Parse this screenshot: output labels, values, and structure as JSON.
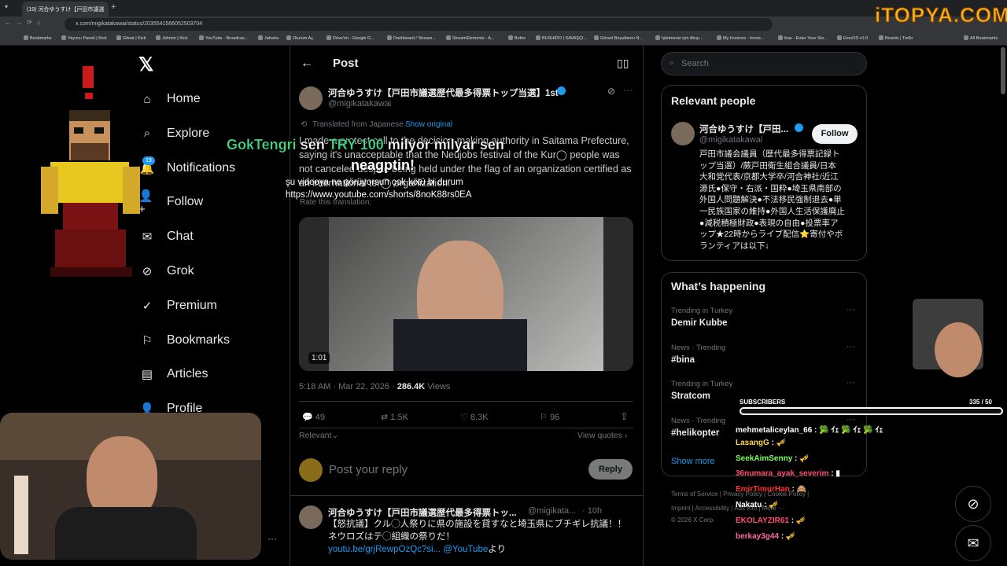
{
  "browser": {
    "tab_title": "(19) 河合ゆうすけ【戸田市議選",
    "url": "x.com/migikatakawai/status/2035541566052503704",
    "bookmarks": [
      "Bookmarks",
      "Yayıncı Paneli | Kick",
      "Gitoat | Kick",
      "Jahmin | Kick",
      "YouTube - Broadcas...",
      "Jaharia",
      "Oturum Aç",
      "Drive'ım - Google D...",
      "Dashboard / Stream...",
      "StreamElements - A...",
      "Botrix",
      "BUSHIDO | SAVAŞÇI...",
      "Görsel Boyutlarını N...",
      "İşletmeniz için Akışı...",
      "My Invoices - Invoic...",
      "ikas - Enter Your Sto...",
      "EmuOS v1.0",
      "Boards | Trello",
      "All Bookmarks"
    ]
  },
  "nav": {
    "items": [
      "Home",
      "Explore",
      "Notifications",
      "Follow",
      "Chat",
      "Grok",
      "Premium",
      "Bookmarks",
      "Articles",
      "Profile"
    ],
    "notif_count": "19"
  },
  "post": {
    "header": "Post",
    "author_name": "河合ゆうすけ【戸田市議選歴代最多得票トップ当選】1st",
    "handle": "@migikatakawai",
    "translated_label": "Translated from Japanese",
    "show_original": "Show original",
    "text": "I made a protest call to the decision-making authority in Saitama Prefecture, saying it's unacceptable that the Neujobs festival of the Kur◯ people was not canceled despite being held under the flag of an organization certified as an international ter◯ organization.",
    "link": "https://www.youtube.com/shorts/8noK88rs0EA",
    "rate": "Rate this translation:",
    "video_duration": "1:01",
    "time": "5:18 AM · Mar 22, 2026 · ",
    "views": "286.4K",
    "views_label": " Views",
    "replies": "49",
    "reposts": "1.5K",
    "likes": "8.3K",
    "bookmarks": "96",
    "relevant": "Relevant",
    "view_quotes": "View quotes",
    "reply_placeholder": "Post your reply",
    "reply_button": "Reply"
  },
  "reply": {
    "author": "河合ゆうすけ【戸田市議選歴代最多得票トッ...",
    "handle": "@migikata...",
    "time": "· 10h",
    "text": "【怒抗議】クル◯人祭りに県の施設を貸すなと埼玉県にブチギレ抗議！！ネウロズはテ◯組織の祭りだ！",
    "link": "youtu.be/grjRewpOzQc?si...",
    "link2": "@YouTube",
    "suffix": "より"
  },
  "sidebar": {
    "search_placeholder": "Search",
    "relevant_title": "Relevant people",
    "person_name": "河合ゆうすけ【戸田...",
    "person_handle": "@migikatakawai",
    "follow": "Follow",
    "bio": [
      "戸田市議会議員（歴代最多得票記録ト",
      "ップ当選）/蕨戸田衛生組合議員/日本",
      "大和党代表/京都大学卒/河合神社/近江",
      "源氏●保守・右派・国粋●埼玉県南部の",
      "外国人問題解決●不法移民強制退去●単",
      "一民族国家の維持●外国人生活保護廃止",
      "●減税積極財政●表現の自由●投票率ア",
      "ップ★22時からライブ配信⭐寄付やボ",
      "ランティアは以下↓"
    ],
    "happening_title": "What’s happening",
    "trends": [
      {
        "meta": "Trending in Turkey",
        "name": "Demir Kubbe"
      },
      {
        "meta": "News · Trending",
        "name": "#bina"
      },
      {
        "meta": "Trending in Turkey",
        "name": "Stratcom"
      },
      {
        "meta": "News · Trending",
        "name": "#helikopter"
      }
    ],
    "show_more": "Show more",
    "footer1": "Terms of Service  |  Privacy Policy  |  Cookie Policy  |",
    "footer2": "Imprint  |  Accessibility  |  Ads info  |  More ···",
    "footer3": "© 2026 X Corp."
  },
  "overlay": {
    "logo": "iTOPYA.COM",
    "donation_name": "GokTengri",
    "donation_mid": " sen ",
    "donation_amount": "TRY 100",
    "donation_rest": " milyor milyar sen",
    "donation_line2": "neagptin!",
    "tts": "şu videoya ne görüyorsun çok kötü bi durum",
    "subs_label": "SUBSCRIBERS",
    "subs_count": "335  / 50",
    "chat": [
      {
        "user": "mehmetaliceylan_66",
        "color": "#ffffff",
        "msg": " : 🥦 ｲｪ 🥦 ｲｪ 🥦 ｲｪ"
      },
      {
        "user": "LasangG",
        "color": "#ffd54a",
        "msg": " : 🎺"
      },
      {
        "user": "SeekAimSenny",
        "color": "#7cff5a",
        "msg": " : 🎺"
      },
      {
        "user": "36numara_ayak_severim",
        "color": "#ff4d6d",
        "msg": " : ▮"
      },
      {
        "user": "EmirTimurHan",
        "color": "#ff3030",
        "msg": " : 🙈"
      },
      {
        "user": "Nakatu",
        "color": "#ffffff",
        "msg": " : 🎺"
      },
      {
        "user": "EKOLAYZIR61",
        "color": "#ff4d6d",
        "msg": " : 🎺"
      },
      {
        "user": "berkay3g44",
        "color": "#ff6b9e",
        "msg": " : 🎺"
      }
    ]
  }
}
